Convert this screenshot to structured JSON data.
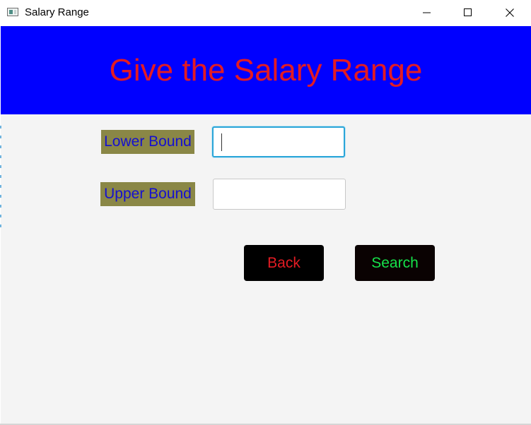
{
  "window": {
    "title": "Salary Range",
    "controls": {
      "minimize_icon": "minimize-icon",
      "maximize_icon": "maximize-icon",
      "close_icon": "close-icon"
    }
  },
  "header": {
    "title": "Give the Salary Range",
    "background_color": "#0000ff",
    "text_color": "#e31b23"
  },
  "form": {
    "lower_bound": {
      "label": "Lower Bound",
      "value": "",
      "placeholder": "",
      "focused": true
    },
    "upper_bound": {
      "label": "Upper Bound",
      "value": "",
      "placeholder": ""
    },
    "label_background_color": "#8a8746",
    "label_text_color": "#1510cf"
  },
  "actions": {
    "back_label": "Back",
    "search_label": "Search",
    "back_color": "#e31b23",
    "search_color": "#16e34a"
  }
}
